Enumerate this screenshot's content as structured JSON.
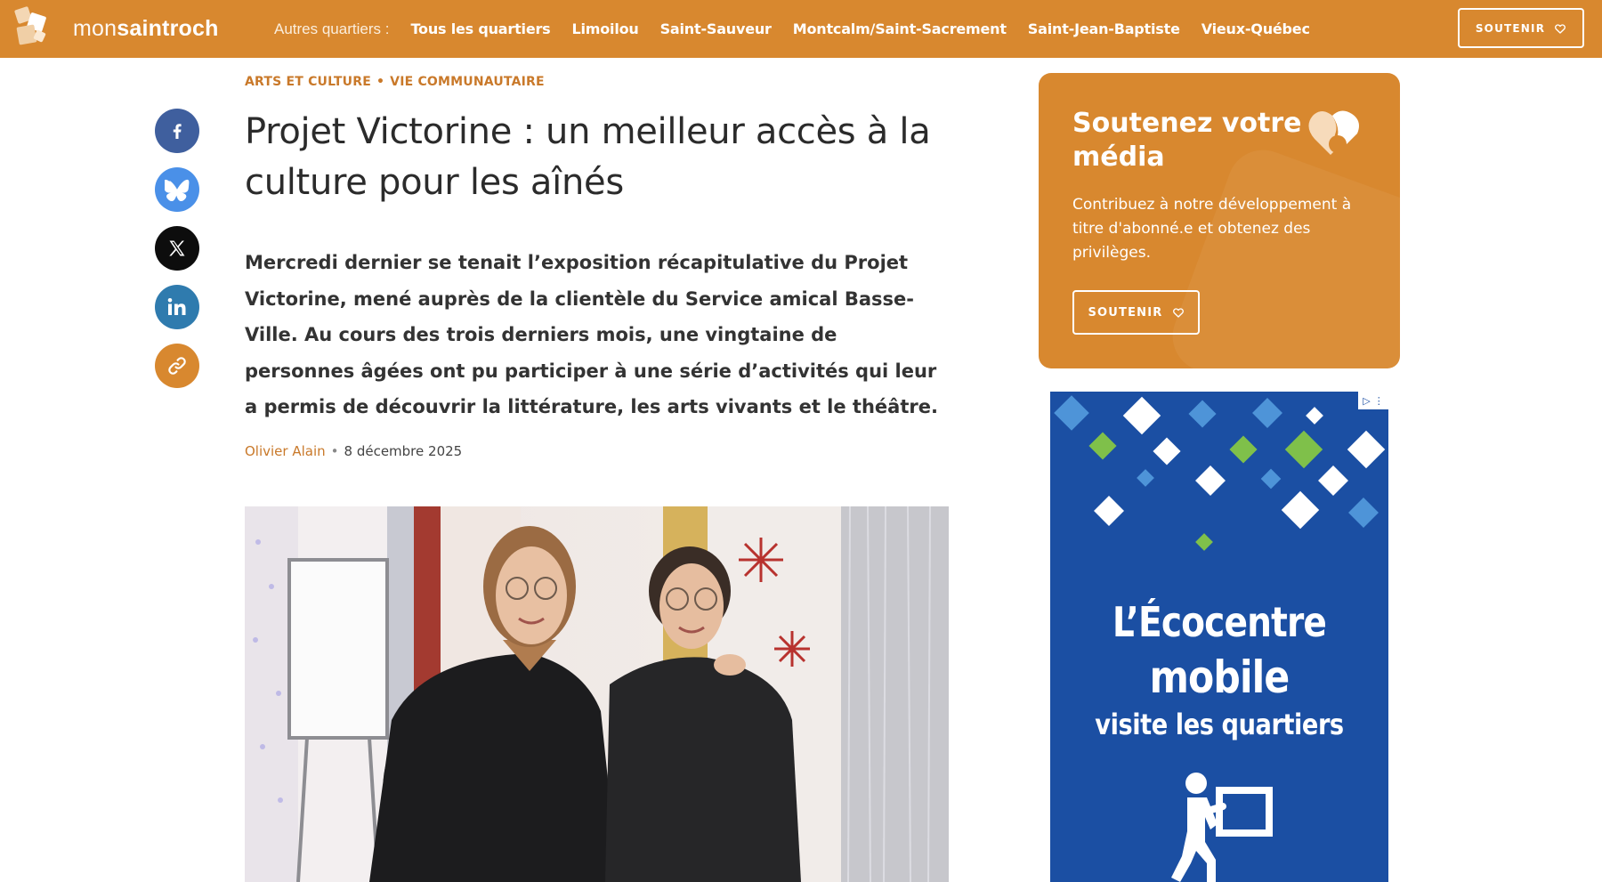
{
  "header": {
    "logo": {
      "text_light": "mon",
      "text_bold": "saintroch"
    },
    "nav_label": "Autres quartiers :",
    "nav_items": [
      "Tous les quartiers",
      "Limoilou",
      "Saint-Sauveur",
      "Montcalm/Saint-Sacrement",
      "Saint-Jean-Baptiste",
      "Vieux-Québec"
    ],
    "support_button": "SOUTENIR",
    "accent_color": "#d8882f"
  },
  "share": {
    "buttons": [
      {
        "icon": "facebook-icon",
        "color": "#3f5f9e"
      },
      {
        "icon": "bluesky-icon",
        "color": "#4a90e8"
      },
      {
        "icon": "x-icon",
        "color": "#0d0d0d"
      },
      {
        "icon": "linkedin-icon",
        "color": "#2f7bae"
      },
      {
        "icon": "link-icon",
        "color": "#d8882f"
      }
    ]
  },
  "article": {
    "categories": [
      "ARTS ET CULTURE",
      "VIE COMMUNAUTAIRE"
    ],
    "category_separator": "•",
    "title": "Projet Victorine : un meilleur accès à la culture pour les aînés",
    "lede": "Mercredi dernier se tenait l’exposition récapitulative du Projet Victorine, mené auprès de la clientèle du Service amical Basse-Ville. Au cours des trois derniers mois, une vingtaine de personnes âgées ont pu participer à une série d’activités qui leur a permis de découvrir la littérature, les arts vivants et le théâtre.",
    "author": "Olivier Alain",
    "byline_separator": "•",
    "date": "8 décembre 2025"
  },
  "sidebar": {
    "support_card": {
      "title": "Soutenez votre média",
      "text": "Contribuez à notre développement à titre d'abonné.e et obtenez des privilèges.",
      "button": "SOUTENIR"
    },
    "ad": {
      "line1": "L’Écocentre",
      "line2": "mobile",
      "line3": "visite les quartiers",
      "background_color": "#1b4fa3"
    }
  }
}
